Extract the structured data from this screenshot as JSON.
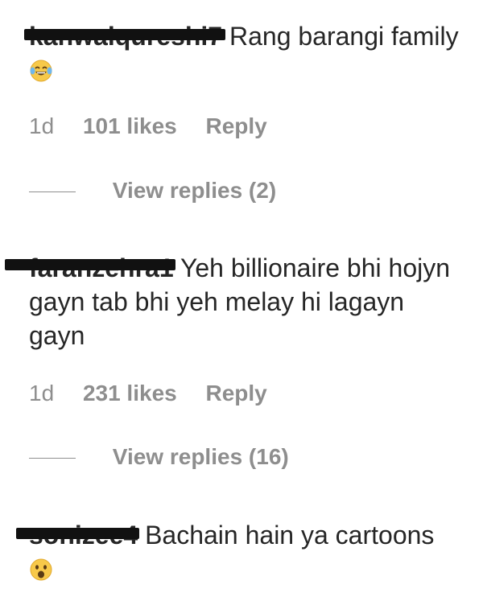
{
  "comments": [
    {
      "username": "kanwalqureshi7",
      "text": "Rang barangi family",
      "emoji": "face-with-tears-of-joy",
      "time": "1d",
      "likes": "101 likes",
      "reply": "Reply",
      "view_replies": "View replies (2)"
    },
    {
      "username": "faranzehra1",
      "text": "Yeh billionaire bhi hojyn gayn tab bhi yeh melay hi lagayn gayn",
      "time": "1d",
      "likes": "231 likes",
      "reply": "Reply",
      "view_replies": "View replies (16)"
    },
    {
      "username": "sonizee4",
      "text": "Bachain hain ya cartoons",
      "emoji": "hushed-face"
    }
  ],
  "colors": {
    "text": "#262626",
    "meta": "#8e8e8e",
    "redaction": "#111111"
  }
}
